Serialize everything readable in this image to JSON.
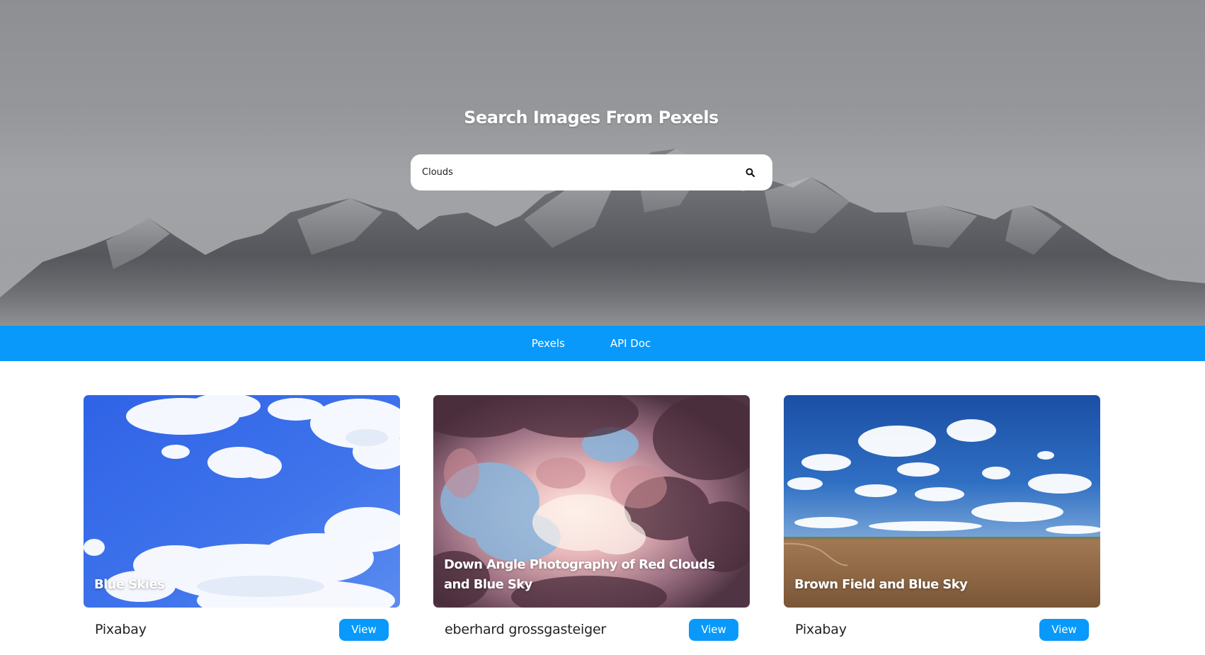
{
  "hero": {
    "title": "Search Images From Pexels",
    "search_value": "Clouds",
    "search_icon": "search-icon"
  },
  "nav": {
    "links": [
      {
        "label": "Pexels"
      },
      {
        "label": "API Doc"
      }
    ]
  },
  "cards": [
    {
      "caption": "Blue Skies",
      "photographer": "Pixabay",
      "button_label": "View"
    },
    {
      "caption": "Down Angle Photography of Red Clouds and Blue Sky",
      "photographer": "eberhard grossgasteiger",
      "button_label": "View"
    },
    {
      "caption": "Brown Field and Blue Sky",
      "photographer": "Pixabay",
      "button_label": "View"
    }
  ],
  "colors": {
    "accent": "#0899fb",
    "hero_bg": "#96979a",
    "text": "#222222"
  }
}
